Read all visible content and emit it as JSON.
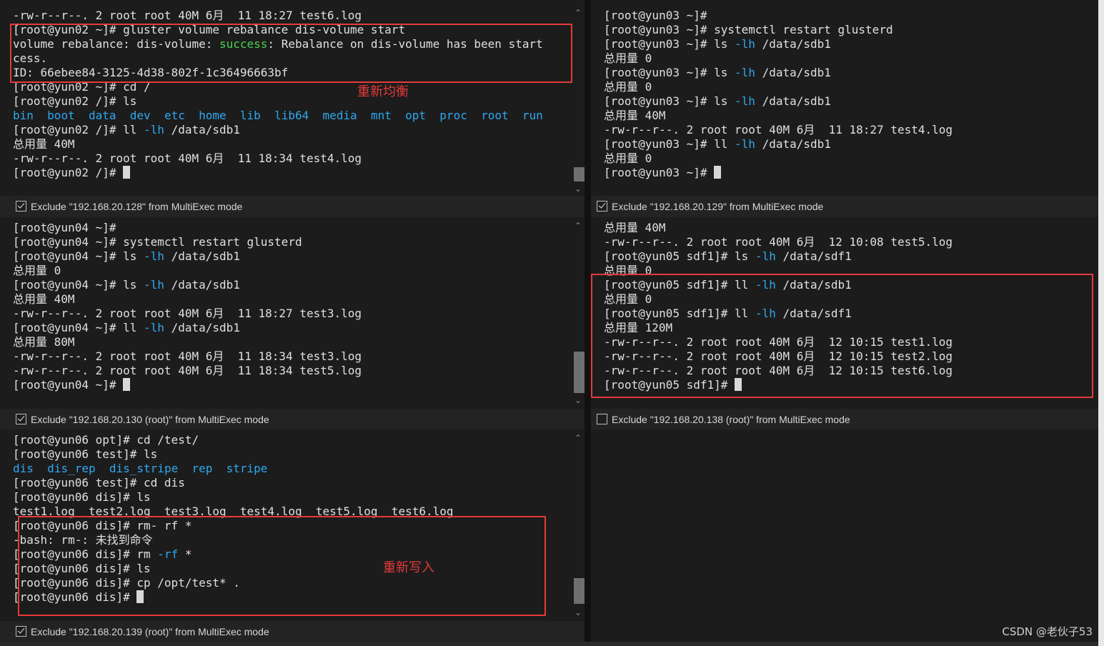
{
  "panes": {
    "p1": {
      "lines": [
        [
          {
            "t": "-rw-r--r--. 2 root root 40M 6月  11 18:27 test6.log"
          }
        ],
        [
          {
            "t": "[root@yun02 ~]# gluster volume rebalance dis-volume start"
          }
        ],
        [
          {
            "t": "volume rebalance: dis-volume: "
          },
          {
            "t": "success",
            "c": "gr"
          },
          {
            "t": ": Rebalance on dis-volume has been start"
          }
        ],
        [
          {
            "t": "cess."
          }
        ],
        [
          {
            "t": "ID: 66ebee84-3125-4d38-802f-1c36496663bf"
          }
        ],
        [
          {
            "t": "[root@yun02 ~]# cd /"
          }
        ],
        [
          {
            "t": "[root@yun02 /]# ls"
          }
        ],
        [
          {
            "t": "bin",
            "c": "bl"
          },
          {
            "t": "  "
          },
          {
            "t": "boot",
            "c": "bl"
          },
          {
            "t": "  "
          },
          {
            "t": "data",
            "c": "bl"
          },
          {
            "t": "  "
          },
          {
            "t": "dev",
            "c": "bl"
          },
          {
            "t": "  "
          },
          {
            "t": "etc",
            "c": "bl"
          },
          {
            "t": "  "
          },
          {
            "t": "home",
            "c": "bl"
          },
          {
            "t": "  "
          },
          {
            "t": "lib",
            "c": "bl"
          },
          {
            "t": "  "
          },
          {
            "t": "lib64",
            "c": "bl"
          },
          {
            "t": "  "
          },
          {
            "t": "media",
            "c": "bl"
          },
          {
            "t": "  "
          },
          {
            "t": "mnt",
            "c": "bl"
          },
          {
            "t": "  "
          },
          {
            "t": "opt",
            "c": "bl"
          },
          {
            "t": "  "
          },
          {
            "t": "proc",
            "c": "bl"
          },
          {
            "t": "  "
          },
          {
            "t": "root",
            "c": "bl"
          },
          {
            "t": "  "
          },
          {
            "t": "run",
            "c": "bl"
          }
        ],
        [
          {
            "t": "[root@yun02 /]# ll "
          },
          {
            "t": "-lh",
            "c": "bl"
          },
          {
            "t": " /data/sdb1"
          }
        ],
        [
          {
            "t": "总用量 40M"
          }
        ],
        [
          {
            "t": "-rw-r--r--. 2 root root 40M 6月  11 18:34 test4.log"
          }
        ],
        [
          {
            "t": "[root@yun02 /]# "
          },
          {
            "cursor": true
          }
        ]
      ],
      "exclude": "Exclude \"192.168.20.128\" from MultiExec mode",
      "exclude_checked": true
    },
    "p2": {
      "lines": [
        [
          {
            "t": "[root@yun03 ~]#"
          }
        ],
        [
          {
            "t": "[root@yun03 ~]# systemctl restart glusterd"
          }
        ],
        [
          {
            "t": "[root@yun03 ~]# ls "
          },
          {
            "t": "-lh",
            "c": "bl"
          },
          {
            "t": " /data/sdb1"
          }
        ],
        [
          {
            "t": "总用量 0"
          }
        ],
        [
          {
            "t": "[root@yun03 ~]# ls "
          },
          {
            "t": "-lh",
            "c": "bl"
          },
          {
            "t": " /data/sdb1"
          }
        ],
        [
          {
            "t": "总用量 0"
          }
        ],
        [
          {
            "t": "[root@yun03 ~]# ls "
          },
          {
            "t": "-lh",
            "c": "bl"
          },
          {
            "t": " /data/sdb1"
          }
        ],
        [
          {
            "t": "总用量 40M"
          }
        ],
        [
          {
            "t": "-rw-r--r--. 2 root root 40M 6月  11 18:27 test4.log"
          }
        ],
        [
          {
            "t": "[root@yun03 ~]# ll "
          },
          {
            "t": "-lh",
            "c": "bl"
          },
          {
            "t": " /data/sdb1"
          }
        ],
        [
          {
            "t": "总用量 0"
          }
        ],
        [
          {
            "t": "[root@yun03 ~]# "
          },
          {
            "cursor": true
          }
        ]
      ],
      "exclude": "Exclude \"192.168.20.129\" from MultiExec mode",
      "exclude_checked": true
    },
    "p3": {
      "lines": [
        [
          {
            "t": "[root@yun04 ~]#"
          }
        ],
        [
          {
            "t": "[root@yun04 ~]# systemctl restart glusterd"
          }
        ],
        [
          {
            "t": "[root@yun04 ~]# ls "
          },
          {
            "t": "-lh",
            "c": "bl"
          },
          {
            "t": " /data/sdb1"
          }
        ],
        [
          {
            "t": "总用量 0"
          }
        ],
        [
          {
            "t": "[root@yun04 ~]# ls "
          },
          {
            "t": "-lh",
            "c": "bl"
          },
          {
            "t": " /data/sdb1"
          }
        ],
        [
          {
            "t": "总用量 40M"
          }
        ],
        [
          {
            "t": "-rw-r--r--. 2 root root 40M 6月  11 18:27 test3.log"
          }
        ],
        [
          {
            "t": "[root@yun04 ~]# ll "
          },
          {
            "t": "-lh",
            "c": "bl"
          },
          {
            "t": " /data/sdb1"
          }
        ],
        [
          {
            "t": "总用量 80M"
          }
        ],
        [
          {
            "t": "-rw-r--r--. 2 root root 40M 6月  11 18:34 test3.log"
          }
        ],
        [
          {
            "t": "-rw-r--r--. 2 root root 40M 6月  11 18:34 test5.log"
          }
        ],
        [
          {
            "t": "[root@yun04 ~]# "
          },
          {
            "cursor": true
          }
        ]
      ],
      "exclude": "Exclude \"192.168.20.130 (root)\" from MultiExec mode",
      "exclude_checked": true
    },
    "p4": {
      "lines": [
        [
          {
            "t": "总用量 40M"
          }
        ],
        [
          {
            "t": "-rw-r--r--. 2 root root 40M 6月  12 10:08 test5.log"
          }
        ],
        [
          {
            "t": "[root@yun05 sdf1]# ls "
          },
          {
            "t": "-lh",
            "c": "bl"
          },
          {
            "t": " /data/sdf1"
          }
        ],
        [
          {
            "t": "总用量 0"
          }
        ],
        [
          {
            "t": "[root@yun05 sdf1]# ll "
          },
          {
            "t": "-lh",
            "c": "bl"
          },
          {
            "t": " /data/sdb1"
          }
        ],
        [
          {
            "t": "总用量 0"
          }
        ],
        [
          {
            "t": "[root@yun05 sdf1]# ll "
          },
          {
            "t": "-lh",
            "c": "bl"
          },
          {
            "t": " /data/sdf1"
          }
        ],
        [
          {
            "t": "总用量 120M"
          }
        ],
        [
          {
            "t": "-rw-r--r--. 2 root root 40M 6月  12 10:15 test1.log"
          }
        ],
        [
          {
            "t": "-rw-r--r--. 2 root root 40M 6月  12 10:15 test2.log"
          }
        ],
        [
          {
            "t": "-rw-r--r--. 2 root root 40M 6月  12 10:15 test6.log"
          }
        ],
        [
          {
            "t": "[root@yun05 sdf1]# "
          },
          {
            "cursor": true
          }
        ]
      ],
      "exclude": "Exclude \"192.168.20.138 (root)\" from MultiExec mode",
      "exclude_checked": false
    },
    "p5": {
      "lines": [
        [
          {
            "t": "[root@yun06 opt]# cd /test/"
          }
        ],
        [
          {
            "t": "[root@yun06 test]# ls"
          }
        ],
        [
          {
            "t": "dis",
            "c": "bl"
          },
          {
            "t": "  "
          },
          {
            "t": "dis_rep",
            "c": "bl"
          },
          {
            "t": "  "
          },
          {
            "t": "dis_stripe",
            "c": "bl"
          },
          {
            "t": "  "
          },
          {
            "t": "rep",
            "c": "bl"
          },
          {
            "t": "  "
          },
          {
            "t": "stripe",
            "c": "bl"
          }
        ],
        [
          {
            "t": "[root@yun06 test]# cd dis"
          }
        ],
        [
          {
            "t": "[root@yun06 dis]# ls"
          }
        ],
        [
          {
            "t": "test1.log  test2.log  test3.log  test4.log  test5.log  test6.log"
          }
        ],
        [
          {
            "t": "[root@yun06 dis]# rm- rf *"
          }
        ],
        [
          {
            "t": "-bash: rm-: 未找到命令"
          }
        ],
        [
          {
            "t": "[root@yun06 dis]# rm "
          },
          {
            "t": "-rf",
            "c": "bl"
          },
          {
            "t": " *"
          }
        ],
        [
          {
            "t": "[root@yun06 dis]# ls"
          }
        ],
        [
          {
            "t": "[root@yun06 dis]# cp /opt/test* ."
          }
        ],
        [
          {
            "t": "[root@yun06 dis]# "
          },
          {
            "cursor": true
          }
        ]
      ],
      "exclude": "Exclude \"192.168.20.139 (root)\" from MultiExec mode",
      "exclude_checked": true
    }
  },
  "annotations": {
    "rebalance": "重新均衡",
    "rewrite": "重新写入"
  },
  "watermark": "CSDN @老伙子53",
  "colors": {
    "background": "#1c1c1c",
    "text": "#e0e0e0",
    "blue": "#2fa8f0",
    "green": "#4bd14b",
    "highlight": "#e53a3a"
  }
}
